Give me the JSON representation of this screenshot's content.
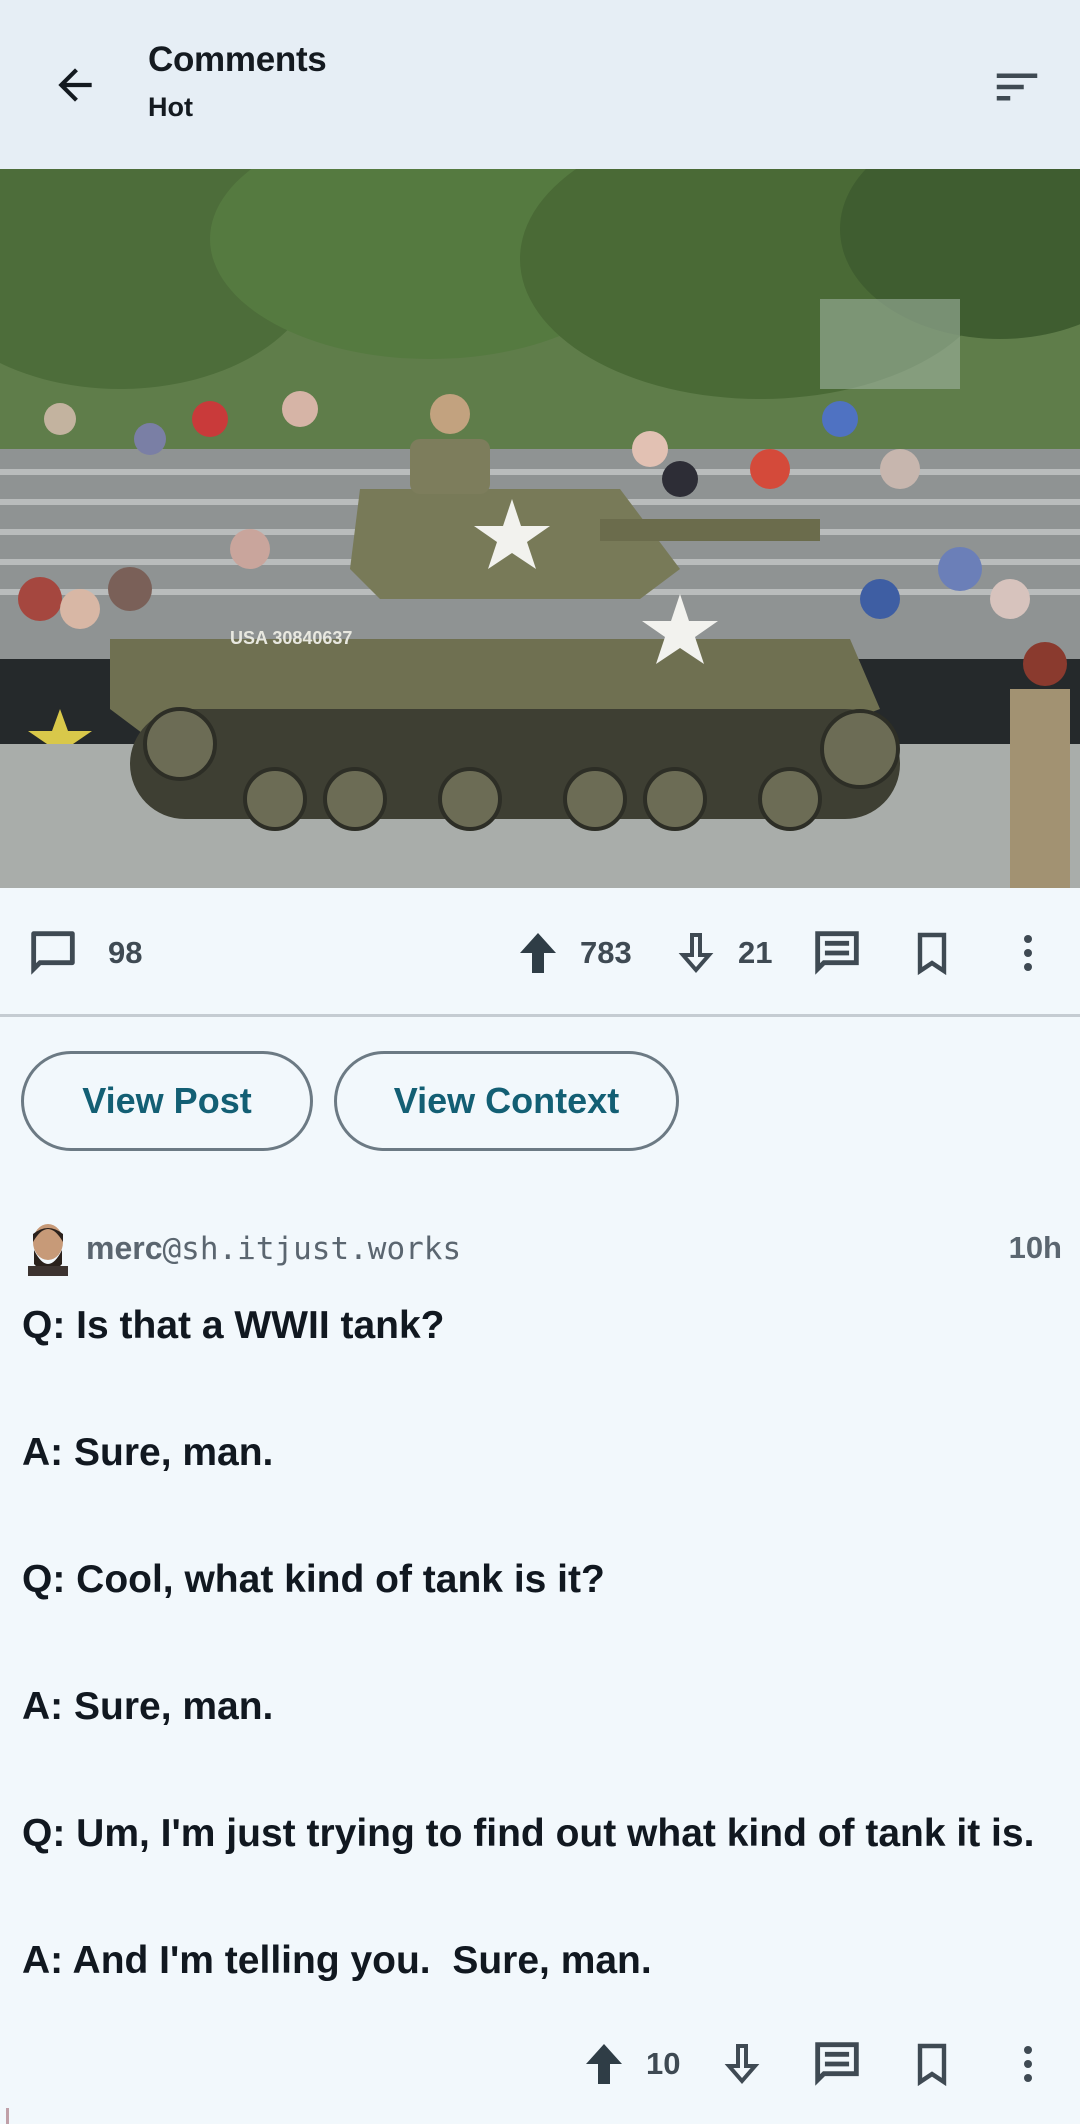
{
  "appbar": {
    "title": "Comments",
    "subtitle": "Hot"
  },
  "post": {
    "image_alt": "tank-parade-photo",
    "comment_count": "98",
    "upvotes": "783",
    "downvotes": "21"
  },
  "buttons": {
    "view_post": "View Post",
    "view_context": "View Context"
  },
  "comment": {
    "username": "merc",
    "instance": "@sh.itjust.works",
    "time": "10h",
    "lines": [
      "Q: Is that a WWII tank?",
      "A: Sure, man.",
      "Q: Cool, what kind of tank is it?",
      "A: Sure, man.",
      "Q: Um, I'm just trying to find out what kind of tank it is.",
      "A: And I'm telling you.  Sure, man."
    ],
    "upvotes": "10"
  },
  "colors": {
    "accent": "#135f74",
    "appbar_bg": "#e6eef5",
    "page_bg": "#f2f8fc",
    "icon": "#3f4a53"
  }
}
